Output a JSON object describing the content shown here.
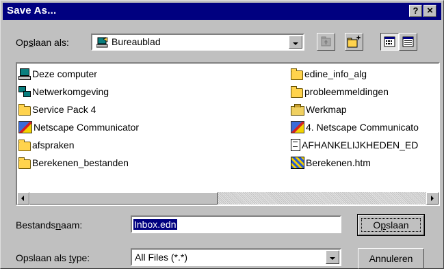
{
  "window": {
    "title": "Save As..."
  },
  "titlebar": {
    "help_label": "?",
    "close_label": "×"
  },
  "location": {
    "label_pre": "Op",
    "label_accel": "s",
    "label_post": "laan als:",
    "value": "Bureaublad"
  },
  "files": {
    "left": [
      {
        "name": "Deze computer",
        "icon": "computer-icon"
      },
      {
        "name": "Netwerkomgeving",
        "icon": "network-icon"
      },
      {
        "name": "Service Pack 4",
        "icon": "folder-icon"
      },
      {
        "name": "Netscape Communicator",
        "icon": "netscape-icon"
      },
      {
        "name": "afspraken",
        "icon": "folder-icon"
      },
      {
        "name": "Berekenen_bestanden",
        "icon": "folder-icon"
      }
    ],
    "right": [
      {
        "name": "edine_info_alg",
        "icon": "folder-icon"
      },
      {
        "name": "probleemmeldingen",
        "icon": "folder-icon"
      },
      {
        "name": "Werkmap",
        "icon": "briefcase-icon"
      },
      {
        "name": "4. Netscape Communicato",
        "icon": "netscape-icon"
      },
      {
        "name": "AFHANKELIJKHEDEN_ED",
        "icon": "document-icon"
      },
      {
        "name": "Berekenen.htm",
        "icon": "webpage-icon"
      }
    ]
  },
  "filename": {
    "label_pre": "Bestands",
    "label_accel": "n",
    "label_post": "aam:",
    "value": "Inbox.edn"
  },
  "filetype": {
    "label_pre": "Opslaan als ",
    "label_accel": "t",
    "label_post": "ype:",
    "value": "All Files (*.*)"
  },
  "buttons": {
    "save_pre": "O",
    "save_accel": "p",
    "save_post": "slaan",
    "cancel": "Annuleren"
  }
}
